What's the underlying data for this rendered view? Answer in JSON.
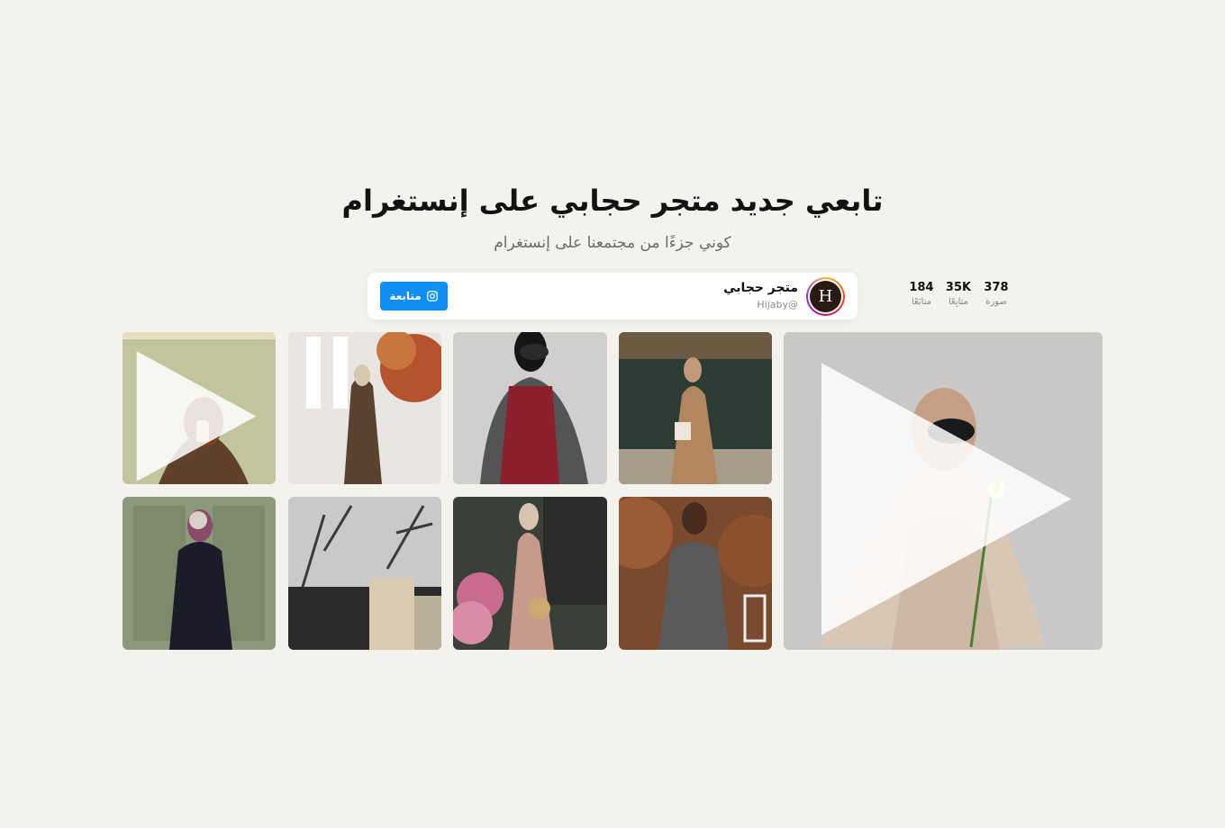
{
  "header": {
    "title": "تابعي جديد متجر حجابي على إنستغرام",
    "subtitle": "كوني جزءًا من مجتمعنا على إنستغرام"
  },
  "profile": {
    "avatar_letter": "H",
    "name": "متجر حجابي",
    "handle": "Hijaby@",
    "stats": [
      {
        "value": "378",
        "label": "صورة"
      },
      {
        "value": "35K",
        "label": "متابِعًا"
      },
      {
        "value": "184",
        "label": "متابَعًا"
      }
    ],
    "follow_label": "متابعة",
    "follow_icon": "instagram-icon",
    "accent_color": "#0f8ff3"
  },
  "gallery": {
    "posts": [
      {
        "name": "featured-post",
        "kind": "video",
        "icon": "play-icon"
      },
      {
        "name": "post-1",
        "kind": "photo"
      },
      {
        "name": "post-2",
        "kind": "photo"
      },
      {
        "name": "post-3",
        "kind": "photo"
      },
      {
        "name": "post-4",
        "kind": "video",
        "icon": "play-icon"
      },
      {
        "name": "post-5",
        "kind": "photo"
      },
      {
        "name": "post-6",
        "kind": "photo"
      },
      {
        "name": "post-7",
        "kind": "photo"
      },
      {
        "name": "post-8",
        "kind": "photo"
      }
    ]
  }
}
